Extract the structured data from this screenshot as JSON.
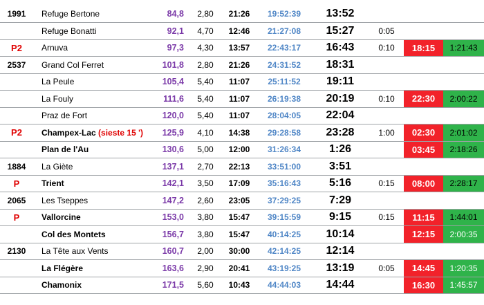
{
  "rows": [
    {
      "alt": "1991",
      "alt_red": false,
      "place": "Refuge Bertone",
      "bold": false,
      "note": "",
      "km": "84,8",
      "slope": "2,80",
      "pace": "21:26",
      "cum": "19:52:39",
      "clock": "13:52",
      "stop": "",
      "arrive": "",
      "rel": "",
      "rel_dark": false
    },
    {
      "alt": "",
      "alt_red": false,
      "place": "Refuge Bonatti",
      "bold": false,
      "note": "",
      "km": "92,1",
      "slope": "4,70",
      "pace": "12:46",
      "cum": "21:27:08",
      "clock": "15:27",
      "stop": "0:05",
      "arrive": "",
      "rel": "",
      "rel_dark": false
    },
    {
      "alt": "P2",
      "alt_red": true,
      "place": "Arnuva",
      "bold": false,
      "note": "",
      "km": "97,3",
      "slope": "4,30",
      "pace": "13:57",
      "cum": "22:43:17",
      "clock": "16:43",
      "stop": "0:10",
      "arrive": "18:15",
      "rel": "1:21:43",
      "rel_dark": false
    },
    {
      "alt": "2537",
      "alt_red": false,
      "place": "Grand Col Ferret",
      "bold": false,
      "note": "",
      "km": "101,8",
      "slope": "2,80",
      "pace": "21:26",
      "cum": "24:31:52",
      "clock": "18:31",
      "stop": "",
      "arrive": "",
      "rel": "",
      "rel_dark": false
    },
    {
      "alt": "",
      "alt_red": false,
      "place": "La Peule",
      "bold": false,
      "note": "",
      "km": "105,4",
      "slope": "5,40",
      "pace": "11:07",
      "cum": "25:11:52",
      "clock": "19:11",
      "stop": "",
      "arrive": "",
      "rel": "",
      "rel_dark": false
    },
    {
      "alt": "",
      "alt_red": false,
      "place": "La Fouly",
      "bold": false,
      "note": "",
      "km": "111,6",
      "slope": "5,40",
      "pace": "11:07",
      "cum": "26:19:38",
      "clock": "20:19",
      "stop": "0:10",
      "arrive": "22:30",
      "rel": "2:00:22",
      "rel_dark": false
    },
    {
      "alt": "",
      "alt_red": false,
      "place": "Praz de Fort",
      "bold": false,
      "note": "",
      "km": "120,0",
      "slope": "5,40",
      "pace": "11:07",
      "cum": "28:04:05",
      "clock": "22:04",
      "stop": "",
      "arrive": "",
      "rel": "",
      "rel_dark": false
    },
    {
      "alt": "P2",
      "alt_red": true,
      "place": "Champex-Lac",
      "bold": true,
      "note": "(sieste 15 ')",
      "km": "125,9",
      "slope": "4,10",
      "pace": "14:38",
      "cum": "29:28:58",
      "clock": "23:28",
      "stop": "1:00",
      "arrive": "02:30",
      "rel": "2:01:02",
      "rel_dark": false
    },
    {
      "alt": "",
      "alt_red": false,
      "place": "Plan de l'Au",
      "bold": true,
      "note": "",
      "km": "130,6",
      "slope": "5,00",
      "pace": "12:00",
      "cum": "31:26:34",
      "clock": "1:26",
      "stop": "",
      "arrive": "03:45",
      "rel": "2:18:26",
      "rel_dark": false
    },
    {
      "alt": "1884",
      "alt_red": false,
      "place": "La Giète",
      "bold": false,
      "note": "",
      "km": "137,1",
      "slope": "2,70",
      "pace": "22:13",
      "cum": "33:51:00",
      "clock": "3:51",
      "stop": "",
      "arrive": "",
      "rel": "",
      "rel_dark": false
    },
    {
      "alt": "P",
      "alt_red": true,
      "place": "Trient",
      "bold": true,
      "note": "",
      "km": "142,1",
      "slope": "3,50",
      "pace": "17:09",
      "cum": "35:16:43",
      "clock": "5:16",
      "stop": "0:15",
      "arrive": "08:00",
      "rel": "2:28:17",
      "rel_dark": false
    },
    {
      "alt": "2065",
      "alt_red": false,
      "place": "Les Tseppes",
      "bold": false,
      "note": "",
      "km": "147,2",
      "slope": "2,60",
      "pace": "23:05",
      "cum": "37:29:25",
      "clock": "7:29",
      "stop": "",
      "arrive": "",
      "rel": "",
      "rel_dark": false
    },
    {
      "alt": "P",
      "alt_red": true,
      "place": "Vallorcine",
      "bold": true,
      "note": "",
      "km": "153,0",
      "slope": "3,80",
      "pace": "15:47",
      "cum": "39:15:59",
      "clock": "9:15",
      "stop": "0:15",
      "arrive": "11:15",
      "rel": "1:44:01",
      "rel_dark": false
    },
    {
      "alt": "",
      "alt_red": false,
      "place": "Col des Montets",
      "bold": true,
      "note": "",
      "km": "156,7",
      "slope": "3,80",
      "pace": "15:47",
      "cum": "40:14:25",
      "clock": "10:14",
      "stop": "",
      "arrive": "12:15",
      "rel": "2:00:35",
      "rel_dark": true
    },
    {
      "alt": "2130",
      "alt_red": false,
      "place": "La Tête aux Vents",
      "bold": false,
      "note": "",
      "km": "160,7",
      "slope": "2,00",
      "pace": "30:00",
      "cum": "42:14:25",
      "clock": "12:14",
      "stop": "",
      "arrive": "",
      "rel": "",
      "rel_dark": false
    },
    {
      "alt": "",
      "alt_red": false,
      "place": "La Flégère",
      "bold": true,
      "note": "",
      "km": "163,6",
      "slope": "2,90",
      "pace": "20:41",
      "cum": "43:19:25",
      "clock": "13:19",
      "stop": "0:05",
      "arrive": "14:45",
      "rel": "1:20:35",
      "rel_dark": true
    },
    {
      "alt": "",
      "alt_red": false,
      "place": "Chamonix",
      "bold": true,
      "note": "",
      "km": "171,5",
      "slope": "5,60",
      "pace": "10:43",
      "cum": "44:44:03",
      "clock": "14:44",
      "stop": "",
      "arrive": "16:30",
      "rel": "1:45:57",
      "rel_dark": true
    }
  ],
  "colors": {
    "red_cell": "#f2222a",
    "green_cell": "#2fb34a",
    "km_purple": "#7b3aa8",
    "cum_blue": "#4f86c6",
    "alert_red": "#e00000"
  }
}
